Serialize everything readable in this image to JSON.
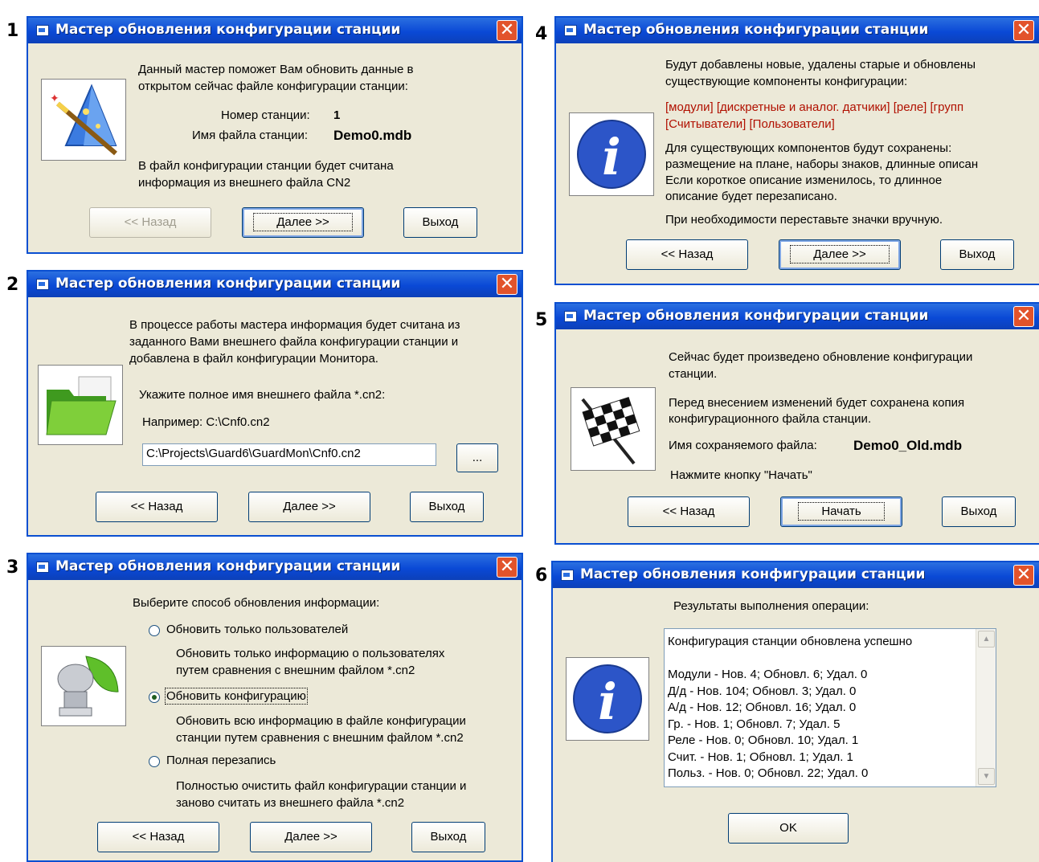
{
  "title": "Мастер обновления конфигурации станции",
  "buttons": {
    "back": "<< Назад",
    "next": "Далее >>",
    "exit": "Выход",
    "start": "Начать",
    "ok": "OK",
    "browse": "..."
  },
  "step_numbers": [
    "1",
    "2",
    "3",
    "4",
    "5",
    "6"
  ],
  "win1": {
    "intro1": "Данный мастер поможет Вам обновить данные в",
    "intro2": "открытом сейчас файле конфигурации станции:",
    "station_label": "Номер станции:",
    "station_value": "1",
    "file_label": "Имя файла станции:",
    "file_value": "Demo0.mdb",
    "note1": "В файл конфигурации станции будет считана",
    "note2": "информация из внешнего файла CN2"
  },
  "win2": {
    "p1": "В процессе работы мастера информация будет считана из",
    "p2": "заданного Вами внешнего файла конфигурации станции и",
    "p3": "добавлена в файл конфигурации Монитора.",
    "prompt": "Укажите полное имя внешнего файла *.cn2:",
    "example": "Например:   C:\\Cnf0.cn2",
    "path_value": "C:\\Projects\\Guard6\\GuardMon\\Cnf0.cn2"
  },
  "win3": {
    "heading": "Выберите способ обновления информации:",
    "options": [
      {
        "label": "Обновить только пользователей",
        "desc1": "Обновить только информацию о пользователях",
        "desc2": "путем сравнения с внешним файлом *.cn2",
        "selected": false
      },
      {
        "label": "Обновить конфигурацию",
        "desc1": "Обновить всю информацию в файле конфигурации",
        "desc2": "станции путем сравнения с внешним файлом *.cn2",
        "selected": true
      },
      {
        "label": "Полная перезапись",
        "desc1": "Полностью очистить файл конфигурации станции и",
        "desc2": "заново считать из внешнего файла *.cn2",
        "selected": false
      }
    ]
  },
  "win4": {
    "l1": "Будут добавлены новые, удалены старые и обновлены",
    "l2": "существующие компоненты конфигурации:",
    "r1": "[модули] [дискретные и аналог. датчики] [реле] [групп",
    "r2": "[Считыватели] [Пользователи]",
    "l3": "Для существующих компонентов будут сохранены:",
    "l4": "размещение на плане, наборы знаков, длинные описан",
    "l5": "Если короткое описание изменилось, то длинное",
    "l6": "описание будет перезаписано.",
    "l7": "При необходимости переставьте значки вручную."
  },
  "win5": {
    "l1": "Сейчас будет произведено обновление конфигурации",
    "l2": "станции.",
    "l3": "Перед внесением изменений будет сохранена копия",
    "l4": "конфигурационного файла станции.",
    "file_label": "Имя сохраняемого файла:",
    "file_value": "Demo0_Old.mdb",
    "press": "Нажмите кнопку \"Начать\""
  },
  "win6": {
    "heading": "Результаты выполнения операции:",
    "results": [
      "Конфигурация станции обновлена успешно",
      "",
      "Модули - Нов. 4; Обновл. 6; Удал. 0",
      "Д/д - Нов. 104; Обновл. 3; Удал. 0",
      "А/д - Нов. 12; Обновл. 16; Удал. 0",
      "Гр. - Нов. 1; Обновл. 7; Удал. 5",
      "Реле - Нов. 0; Обновл. 10; Удал. 1",
      "Счит. - Нов. 1; Обновл. 1; Удал. 1",
      "Польз. - Нов. 0; Обновл. 22; Удал. 0"
    ]
  }
}
